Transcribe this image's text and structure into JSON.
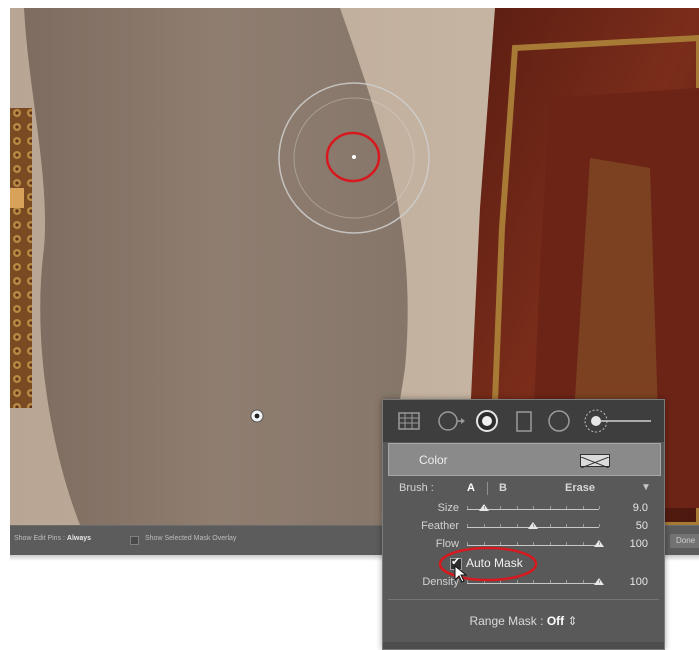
{
  "toolbar": {
    "edit_pins_label": "Show Edit Pins :",
    "edit_pins_value": "Always",
    "mask_overlay_label": "Show Selected Mask Overlay",
    "done_button": "Done"
  },
  "panel": {
    "tools": [
      "crop-overlay-icon",
      "spot-removal-icon",
      "red-eye-icon",
      "graduated-filter-icon",
      "radial-filter-icon",
      "adjustment-brush-icon"
    ],
    "color_label": "Color",
    "brush": {
      "label": "Brush :",
      "option_a": "A",
      "option_b": "B",
      "erase": "Erase"
    },
    "sliders": [
      {
        "label": "Size",
        "value": "9.0",
        "position": 0.13
      },
      {
        "label": "Feather",
        "value": "50",
        "position": 0.5
      },
      {
        "label": "Flow",
        "value": "100",
        "position": 1.0
      },
      {
        "label": "Density",
        "value": "100",
        "position": 1.0
      }
    ],
    "auto_mask": {
      "label": "Auto Mask",
      "checked": true,
      "check_glyph": "✔"
    },
    "range_mask_label": "Range Mask :",
    "range_mask_value": "Off",
    "range_mask_arrows": "⇕"
  },
  "colors": {
    "annotation_red": "#d7191f",
    "panel_bg": "#595959",
    "toolbar_bg": "#5c5c5c"
  }
}
